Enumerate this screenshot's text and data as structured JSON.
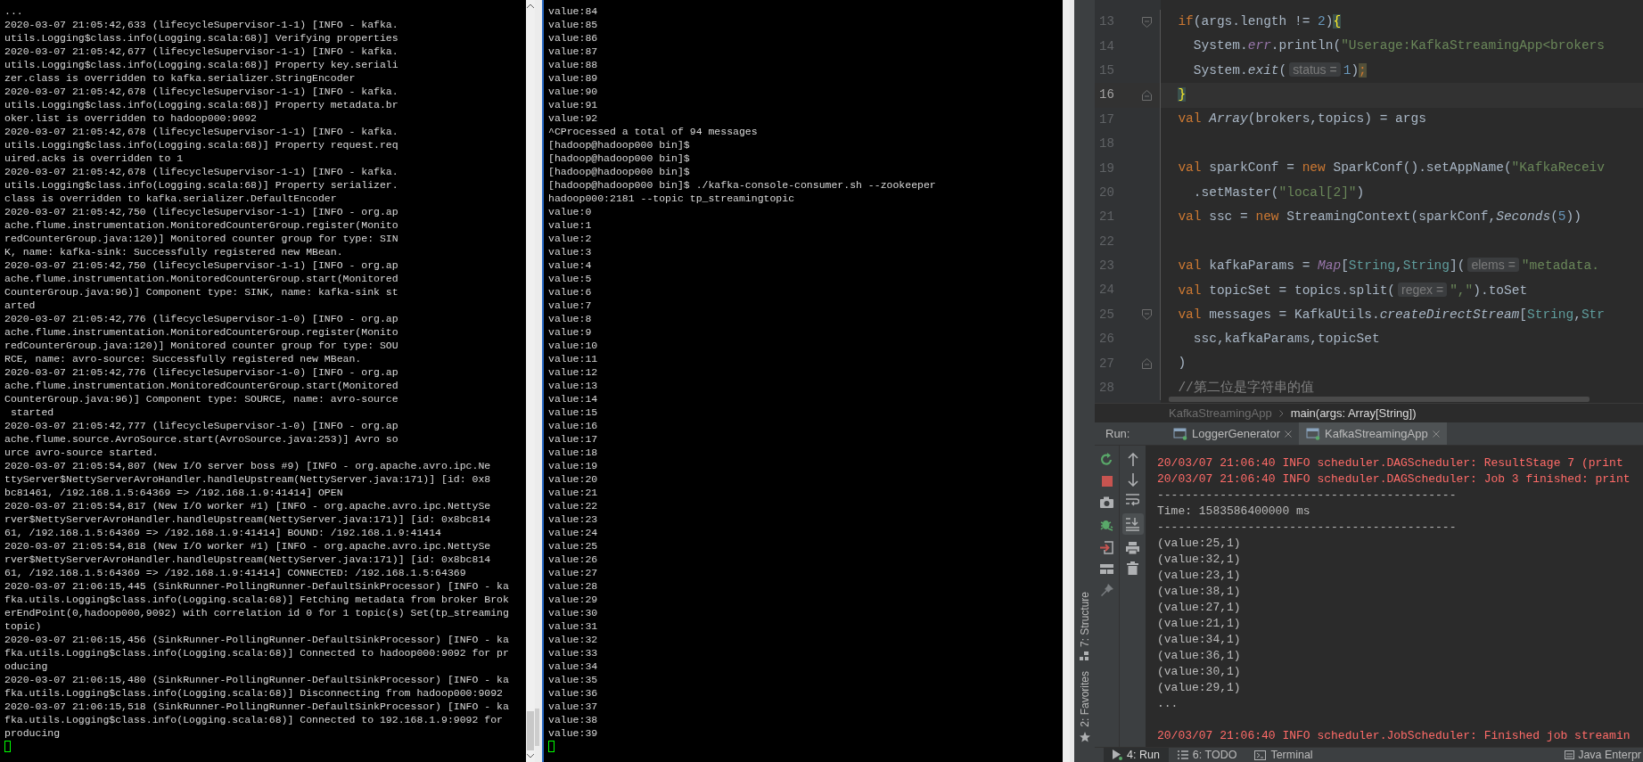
{
  "terminals": [
    {
      "cursor": true,
      "lines": [
        "...",
        "2020-03-07 21:05:42,633 (lifecycleSupervisor-1-1) [INFO - kafka.",
        "utils.Logging$class.info(Logging.scala:68)] Verifying properties",
        "2020-03-07 21:05:42,677 (lifecycleSupervisor-1-1) [INFO - kafka.",
        "utils.Logging$class.info(Logging.scala:68)] Property key.seriali",
        "zer.class is overridden to kafka.serializer.StringEncoder",
        "2020-03-07 21:05:42,678 (lifecycleSupervisor-1-1) [INFO - kafka.",
        "utils.Logging$class.info(Logging.scala:68)] Property metadata.br",
        "oker.list is overridden to hadoop000:9092",
        "2020-03-07 21:05:42,678 (lifecycleSupervisor-1-1) [INFO - kafka.",
        "utils.Logging$class.info(Logging.scala:68)] Property request.req",
        "uired.acks is overridden to 1",
        "2020-03-07 21:05:42,678 (lifecycleSupervisor-1-1) [INFO - kafka.",
        "utils.Logging$class.info(Logging.scala:68)] Property serializer.",
        "class is overridden to kafka.serializer.DefaultEncoder",
        "2020-03-07 21:05:42,750 (lifecycleSupervisor-1-1) [INFO - org.ap",
        "ache.flume.instrumentation.MonitoredCounterGroup.register(Monito",
        "redCounterGroup.java:120)] Monitored counter group for type: SIN",
        "K, name: kafka-sink: Successfully registered new MBean.",
        "2020-03-07 21:05:42,750 (lifecycleSupervisor-1-1) [INFO - org.ap",
        "ache.flume.instrumentation.MonitoredCounterGroup.start(Monitored",
        "CounterGroup.java:96)] Component type: SINK, name: kafka-sink st",
        "arted",
        "2020-03-07 21:05:42,776 (lifecycleSupervisor-1-0) [INFO - org.ap",
        "ache.flume.instrumentation.MonitoredCounterGroup.register(Monito",
        "redCounterGroup.java:120)] Monitored counter group for type: SOU",
        "RCE, name: avro-source: Successfully registered new MBean.",
        "2020-03-07 21:05:42,776 (lifecycleSupervisor-1-0) [INFO - org.ap",
        "ache.flume.instrumentation.MonitoredCounterGroup.start(Monitored",
        "CounterGroup.java:96)] Component type: SOURCE, name: avro-source",
        " started",
        "2020-03-07 21:05:42,777 (lifecycleSupervisor-1-0) [INFO - org.ap",
        "ache.flume.source.AvroSource.start(AvroSource.java:253)] Avro so",
        "urce avro-source started.",
        "2020-03-07 21:05:54,807 (New I/O server boss #9) [INFO - org.apache.avro.ipc.Ne",
        "ttyServer$NettyServerAvroHandler.handleUpstream(NettyServer.java:171)] [id: 0x8",
        "bc81461, /192.168.1.5:64369 => /192.168.1.9:41414] OPEN",
        "2020-03-07 21:05:54,817 (New I/O worker #1) [INFO - org.apache.avro.ipc.NettySe",
        "rver$NettyServerAvroHandler.handleUpstream(NettyServer.java:171)] [id: 0x8bc814",
        "61, /192.168.1.5:64369 => /192.168.1.9:41414] BOUND: /192.168.1.9:41414",
        "2020-03-07 21:05:54,818 (New I/O worker #1) [INFO - org.apache.avro.ipc.NettySe",
        "rver$NettyServerAvroHandler.handleUpstream(NettyServer.java:171)] [id: 0x8bc814",
        "61, /192.168.1.5:64369 => /192.168.1.9:41414] CONNECTED: /192.168.1.5:64369",
        "2020-03-07 21:06:15,445 (SinkRunner-PollingRunner-DefaultSinkProcessor) [INFO - ka",
        "fka.utils.Logging$class.info(Logging.scala:68)] Fetching metadata from broker Brok",
        "erEndPoint(0,hadoop000,9092) with correlation id 0 for 1 topic(s) Set(tp_streaming",
        "topic)",
        "2020-03-07 21:06:15,456 (SinkRunner-PollingRunner-DefaultSinkProcessor) [INFO - ka",
        "fka.utils.Logging$class.info(Logging.scala:68)] Connected to hadoop000:9092 for pr",
        "oducing",
        "2020-03-07 21:06:15,480 (SinkRunner-PollingRunner-DefaultSinkProcessor) [INFO - ka",
        "fka.utils.Logging$class.info(Logging.scala:68)] Disconnecting from hadoop000:9092",
        "2020-03-07 21:06:15,518 (SinkRunner-PollingRunner-DefaultSinkProcessor) [INFO - ka",
        "fka.utils.Logging$class.info(Logging.scala:68)] Connected to 192.168.1.9:9092 for",
        "producing"
      ]
    },
    {
      "cursor": true,
      "lines": [
        "value:84",
        "value:85",
        "value:86",
        "value:87",
        "value:88",
        "value:89",
        "value:90",
        "value:91",
        "value:92",
        "^CProcessed a total of 94 messages",
        "[hadoop@hadoop000 bin]$",
        "[hadoop@hadoop000 bin]$",
        "[hadoop@hadoop000 bin]$",
        "[hadoop@hadoop000 bin]$ ./kafka-console-consumer.sh --zookeeper",
        "hadoop000:2181 --topic tp_streamingtopic",
        "value:0",
        "value:1",
        "value:2",
        "value:3",
        "value:4",
        "value:5",
        "value:6",
        "value:7",
        "value:8",
        "value:9",
        "value:10",
        "value:11",
        "value:12",
        "value:13",
        "value:14",
        "value:15",
        "value:16",
        "value:17",
        "value:18",
        "value:19",
        "value:20",
        "value:21",
        "value:22",
        "value:23",
        "value:24",
        "value:25",
        "value:26",
        "value:27",
        "value:28",
        "value:29",
        "value:30",
        "value:31",
        "value:32",
        "value:33",
        "value:34",
        "value:35",
        "value:36",
        "value:37",
        "value:38",
        "value:39"
      ]
    }
  ],
  "ide": {
    "code_lines": [
      {
        "number": "13",
        "fold_open": true,
        "fold_close": false,
        "current": false,
        "tokens": [
          {
            "kind": "keyword",
            "text": "  if"
          },
          {
            "kind": "plain",
            "text": "(args.length != "
          },
          {
            "kind": "number",
            "text": "2"
          },
          {
            "kind": "plain",
            "text": ")"
          },
          {
            "kind": "match",
            "text": "{"
          }
        ]
      },
      {
        "number": "14",
        "fold_open": false,
        "fold_close": false,
        "current": false,
        "tokens": [
          {
            "kind": "plain",
            "text": "    System."
          },
          {
            "kind": "field",
            "text": "err"
          },
          {
            "kind": "plain",
            "text": ".println("
          },
          {
            "kind": "string",
            "text": "\"Userage:KafkaStreamingApp<brokers"
          }
        ]
      },
      {
        "number": "15",
        "fold_open": false,
        "fold_close": false,
        "current": false,
        "tokens": [
          {
            "kind": "plain",
            "text": "    System."
          },
          {
            "kind": "italic",
            "text": "exit"
          },
          {
            "kind": "plain",
            "text": "("
          },
          {
            "kind": "hint",
            "text": "status ="
          },
          {
            "kind": "number",
            "text": "1"
          },
          {
            "kind": "plain",
            "text": ")"
          },
          {
            "kind": "warning",
            "text": ";"
          }
        ]
      },
      {
        "number": "16",
        "fold_open": false,
        "fold_close": true,
        "current": true,
        "tokens": [
          {
            "kind": "match",
            "text": "  }"
          }
        ]
      },
      {
        "number": "17",
        "fold_open": false,
        "fold_close": false,
        "current": false,
        "tokens": [
          {
            "kind": "keyword",
            "text": "  val "
          },
          {
            "kind": "italic",
            "text": "Array"
          },
          {
            "kind": "plain",
            "text": "(brokers,topics) = args"
          }
        ]
      },
      {
        "number": "18",
        "fold_open": false,
        "fold_close": false,
        "current": false
      },
      {
        "number": "19",
        "fold_open": false,
        "fold_close": false,
        "current": false,
        "tokens": [
          {
            "kind": "keyword",
            "text": "  val "
          },
          {
            "kind": "plain",
            "text": "sparkConf = "
          },
          {
            "kind": "keyword",
            "text": "new "
          },
          {
            "kind": "plain",
            "text": "SparkConf().setAppName("
          },
          {
            "kind": "string",
            "text": "\"KafkaReceiv"
          }
        ]
      },
      {
        "number": "20",
        "fold_open": false,
        "fold_close": false,
        "current": false,
        "tokens": [
          {
            "kind": "plain",
            "text": "    .setMaster("
          },
          {
            "kind": "string",
            "text": "\"local[2]\""
          },
          {
            "kind": "plain",
            "text": ")"
          }
        ]
      },
      {
        "number": "21",
        "fold_open": false,
        "fold_close": false,
        "current": false,
        "tokens": [
          {
            "kind": "keyword",
            "text": "  val "
          },
          {
            "kind": "plain",
            "text": "ssc = "
          },
          {
            "kind": "keyword",
            "text": "new "
          },
          {
            "kind": "plain",
            "text": "StreamingContext(sparkConf,"
          },
          {
            "kind": "italic",
            "text": "Seconds"
          },
          {
            "kind": "plain",
            "text": "("
          },
          {
            "kind": "number",
            "text": "5"
          },
          {
            "kind": "plain",
            "text": "))"
          }
        ]
      },
      {
        "number": "22",
        "fold_open": false,
        "fold_close": false,
        "current": false
      },
      {
        "number": "23",
        "fold_open": false,
        "fold_close": false,
        "current": false,
        "tokens": [
          {
            "kind": "keyword",
            "text": "  val "
          },
          {
            "kind": "plain",
            "text": "kafkaParams = "
          },
          {
            "kind": "field",
            "text": "Map"
          },
          {
            "kind": "plain",
            "text": "["
          },
          {
            "kind": "type",
            "text": "String"
          },
          {
            "kind": "plain",
            "text": ","
          },
          {
            "kind": "type",
            "text": "String"
          },
          {
            "kind": "plain",
            "text": "]("
          },
          {
            "kind": "hint",
            "text": "elems ="
          },
          {
            "kind": "string",
            "text": "\"metadata."
          }
        ]
      },
      {
        "number": "24",
        "fold_open": false,
        "fold_close": false,
        "current": false,
        "tokens": [
          {
            "kind": "keyword",
            "text": "  val "
          },
          {
            "kind": "plain",
            "text": "topicSet = topics.split("
          },
          {
            "kind": "hint",
            "text": "regex ="
          },
          {
            "kind": "string",
            "text": "\",\""
          },
          {
            "kind": "plain",
            "text": ").toSet"
          }
        ]
      },
      {
        "number": "25",
        "fold_open": true,
        "fold_close": false,
        "current": false,
        "tokens": [
          {
            "kind": "keyword",
            "text": "  val "
          },
          {
            "kind": "plain",
            "text": "messages = KafkaUtils."
          },
          {
            "kind": "italic",
            "text": "createDirectStream"
          },
          {
            "kind": "plain",
            "text": "["
          },
          {
            "kind": "type",
            "text": "String"
          },
          {
            "kind": "plain",
            "text": ","
          },
          {
            "kind": "type",
            "text": "Str"
          }
        ]
      },
      {
        "number": "26",
        "fold_open": false,
        "fold_close": false,
        "current": false,
        "tokens": [
          {
            "kind": "plain",
            "text": "    ssc,kafkaParams,topicSet"
          }
        ]
      },
      {
        "number": "27",
        "fold_open": false,
        "fold_close": true,
        "current": false,
        "tokens": [
          {
            "kind": "plain",
            "text": "  )"
          }
        ]
      },
      {
        "number": "28",
        "fold_open": false,
        "fold_close": false,
        "current": false,
        "tokens": [
          {
            "kind": "comment",
            "text": "  //第二位是字符串的值"
          }
        ]
      }
    ],
    "breadcrumb": [
      "KafkaStreamingApp",
      "main(args: Array[String])"
    ],
    "run_panel": {
      "label": "Run:",
      "scroll_to_end_on": true,
      "tabs": [
        {
          "label": "LoggerGenerator",
          "selected": false
        },
        {
          "label": "KafkaStreamingApp",
          "selected": true
        }
      ],
      "console": [
        {
          "kind": "info",
          "text": "20/03/07 21:06:40 INFO scheduler.DAGScheduler: ResultStage 7 (print"
        },
        {
          "kind": "info",
          "text": "20/03/07 21:06:40 INFO scheduler.DAGScheduler: Job 3 finished: print"
        },
        {
          "kind": "plain",
          "text": "-------------------------------------------"
        },
        {
          "kind": "plain",
          "text": "Time: 1583586400000 ms"
        },
        {
          "kind": "plain",
          "text": "-------------------------------------------"
        },
        {
          "kind": "plain",
          "text": "(value:25,1)"
        },
        {
          "kind": "plain",
          "text": "(value:32,1)"
        },
        {
          "kind": "plain",
          "text": "(value:23,1)"
        },
        {
          "kind": "plain",
          "text": "(value:38,1)"
        },
        {
          "kind": "plain",
          "text": "(value:27,1)"
        },
        {
          "kind": "plain",
          "text": "(value:21,1)"
        },
        {
          "kind": "plain",
          "text": "(value:34,1)"
        },
        {
          "kind": "plain",
          "text": "(value:36,1)"
        },
        {
          "kind": "plain",
          "text": "(value:30,1)"
        },
        {
          "kind": "plain",
          "text": "(value:29,1)"
        },
        {
          "kind": "plain",
          "text": "..."
        },
        {
          "kind": "info",
          "spaced": true,
          "text": "20/03/07 21:06:40 INFO scheduler.JobScheduler: Finished job streamin"
        }
      ]
    },
    "tool_strip": [
      "7: Structure",
      "2: Favorites"
    ],
    "bottom_tabs": [
      {
        "label": "4: Run",
        "selected": true
      },
      {
        "label": "6: TODO",
        "selected": false
      },
      {
        "label": "Terminal",
        "selected": false
      }
    ],
    "bottom_right": "Java Enterpr"
  }
}
